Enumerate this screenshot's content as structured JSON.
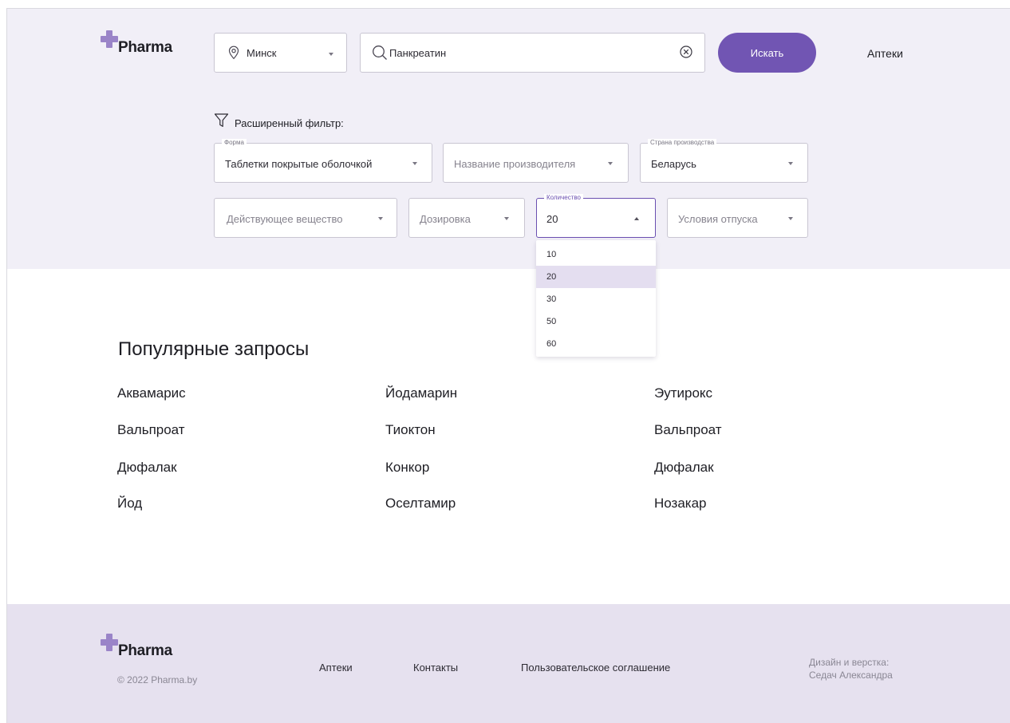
{
  "brand": {
    "name": "Pharma"
  },
  "header": {
    "city": "Минск",
    "search_value": "Панкреатин",
    "search_button": "Искать",
    "nav_link": "Аптеки"
  },
  "filter": {
    "title": "Расширенный фильтр:",
    "form": {
      "legend": "Форма",
      "value": "Таблетки покрытые оболочкой"
    },
    "manufacturer": {
      "placeholder": "Название производителя"
    },
    "country": {
      "legend": "Страна производства",
      "value": "Беларусь"
    },
    "substance": {
      "placeholder": "Действующее вещество"
    },
    "dosage": {
      "placeholder": "Дозировка"
    },
    "quantity": {
      "legend": "Количество",
      "value": "20",
      "options": [
        "10",
        "20",
        "30",
        "50",
        "60"
      ],
      "selected_index": 1
    },
    "conditions": {
      "placeholder": "Условия отпуска"
    }
  },
  "popular": {
    "title": "Популярные запросы",
    "items": [
      "Аквамарис",
      "Йодамарин",
      "Эутирокс",
      "Вальпроат",
      "Тиоктон",
      "Вальпроат",
      "Дюфалак",
      "Конкор",
      "Дюфалак",
      "Йод",
      "Оселтамир",
      "Нозакар"
    ]
  },
  "footer": {
    "copyright": "© 2022 Pharma.by",
    "links": [
      "Аптеки",
      "Контакты",
      "Пользовательское соглашение"
    ],
    "credits_line1": "Дизайн и верстка:",
    "credits_line2": "Седач Александра"
  },
  "colors": {
    "accent": "#7155b3",
    "hero_bg": "#f1eff7",
    "footer_bg": "#e6e1ef",
    "logo": "#9a84c8"
  }
}
